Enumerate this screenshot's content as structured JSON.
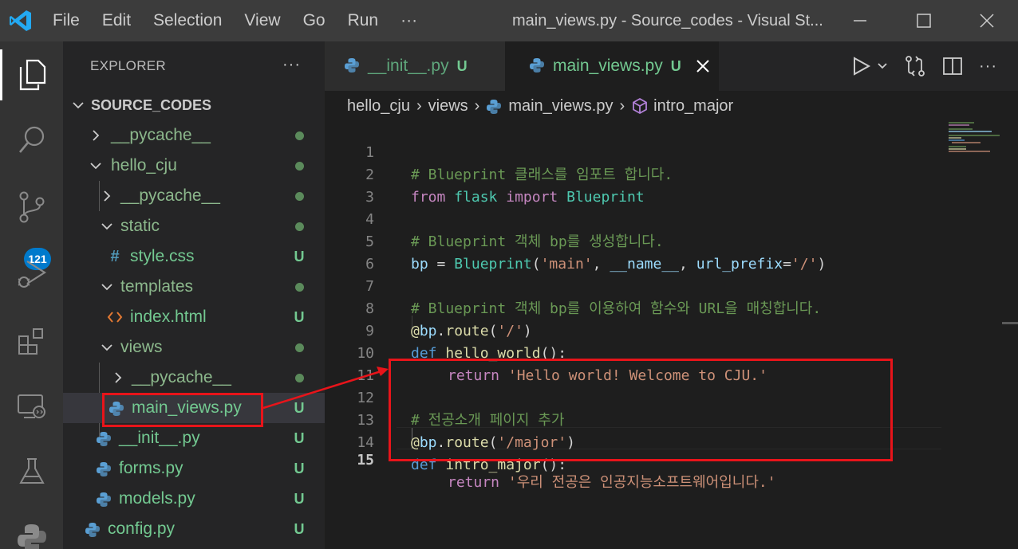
{
  "menu": [
    "File",
    "Edit",
    "Selection",
    "View",
    "Go",
    "Run",
    "···"
  ],
  "window_title": "main_views.py - Source_codes - Visual St...",
  "activity_badge": "121",
  "explorer": {
    "title": "EXPLORER",
    "more": "···",
    "root": "SOURCE_CODES",
    "items": [
      {
        "label": "__pycache__",
        "status": "dot"
      },
      {
        "label": "hello_cju",
        "status": "dot"
      },
      {
        "label": "__pycache__",
        "status": "dot"
      },
      {
        "label": "static",
        "status": "dot"
      },
      {
        "label": "style.css",
        "status": "U"
      },
      {
        "label": "templates",
        "status": "dot"
      },
      {
        "label": "index.html",
        "status": "U"
      },
      {
        "label": "views",
        "status": "dot"
      },
      {
        "label": "__pycache__",
        "status": "dot"
      },
      {
        "label": "main_views.py",
        "status": "U"
      },
      {
        "label": "__init__.py",
        "status": "U"
      },
      {
        "label": "forms.py",
        "status": "U"
      },
      {
        "label": "models.py",
        "status": "U"
      },
      {
        "label": "config.py",
        "status": "U"
      }
    ]
  },
  "tabs": [
    {
      "label": "__init__.py",
      "status": "U"
    },
    {
      "label": "main_views.py",
      "status": "U"
    }
  ],
  "breadcrumb": [
    "hello_cju",
    "views",
    "main_views.py",
    "intro_major"
  ],
  "code": {
    "l1": "# Blueprint 클래스를 임포트 합니다.",
    "l2_from": "from",
    "l2_mod": "flask",
    "l2_import": "import",
    "l2_name": "Blueprint",
    "l4": "# Blueprint 객체 bp를 생성합니다.",
    "l5_bp": "bp",
    "l5_eq": " = ",
    "l5_cls": "Blueprint",
    "l5_p1": "(",
    "l5_s1": "'main'",
    "l5_c1": ", ",
    "l5_name": "__name__",
    "l5_c2": ", ",
    "l5_kw": "url_prefix",
    "l5_eq2": "=",
    "l5_s2": "'/'",
    "l5_p2": ")",
    "l7": "# Blueprint 객체 bp를 이용하여 함수와 URL을 매칭합니다.",
    "l8_at": "@",
    "l8_bp": "bp",
    "l8_dot": ".",
    "l8_fn": "route",
    "l8_p1": "(",
    "l8_s": "'/'",
    "l8_p2": ")",
    "l9_def": "def",
    "l9_fn": "hello_world",
    "l9_rest": "():",
    "l10_ret": "return",
    "l10_s": "'Hello world! Welcome to CJU.'",
    "l12": "# 전공소개 페이지 추가",
    "l13_at": "@",
    "l13_bp": "bp",
    "l13_dot": ".",
    "l13_fn": "route",
    "l13_p1": "(",
    "l13_s": "'/major'",
    "l13_p2": ")",
    "l14_def": "def",
    "l14_fn": "intro_major",
    "l14_rest": "():",
    "l15_ret": "return",
    "l15_s": "'우리 전공은 인공지능소프트웨어입니다.'"
  },
  "line_numbers": [
    "1",
    "2",
    "3",
    "4",
    "5",
    "6",
    "7",
    "8",
    "9",
    "10",
    "11",
    "12",
    "13",
    "14",
    "15"
  ],
  "colors": {
    "annotation": "#e8141a",
    "accent": "#007acc",
    "untracked": "#73c991"
  }
}
